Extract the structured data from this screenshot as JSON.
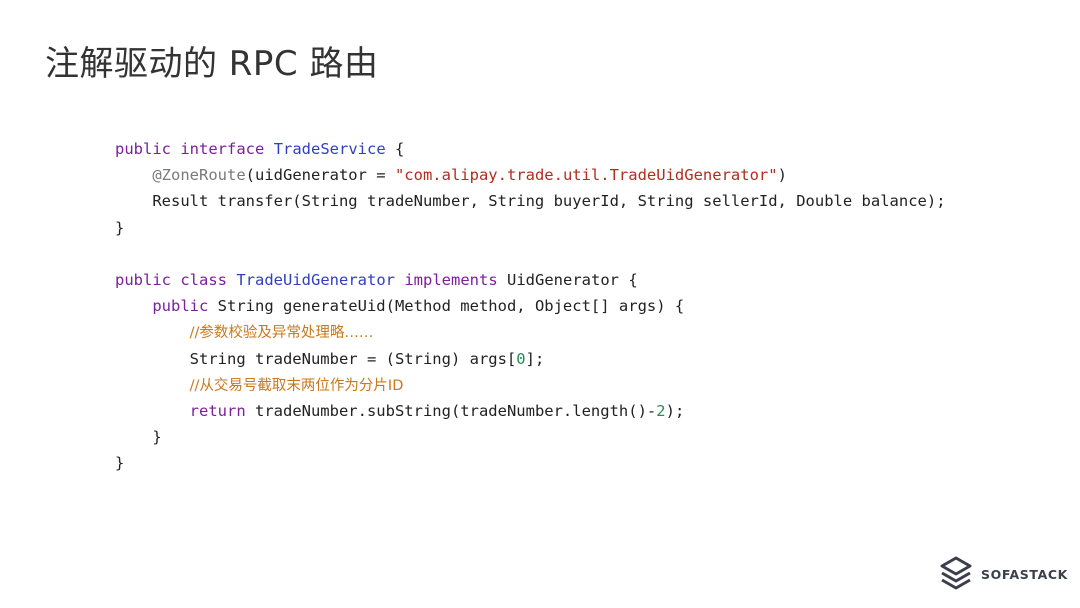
{
  "slide": {
    "title": "注解驱动的 RPC 路由"
  },
  "code": {
    "lines": [
      [
        {
          "t": "public",
          "k": "keyword"
        },
        {
          "t": " ",
          "k": "plain"
        },
        {
          "t": "interface",
          "k": "keyword"
        },
        {
          "t": " ",
          "k": "plain"
        },
        {
          "t": "TradeService",
          "k": "type"
        },
        {
          "t": " {",
          "k": "plain"
        }
      ],
      [
        {
          "t": "    ",
          "k": "plain"
        },
        {
          "t": "@ZoneRoute",
          "k": "annotation"
        },
        {
          "t": "(uidGenerator = ",
          "k": "plain"
        },
        {
          "t": "\"com.alipay.trade.util.TradeUidGenerator\"",
          "k": "string"
        },
        {
          "t": ")",
          "k": "plain"
        }
      ],
      [
        {
          "t": "    Result transfer(String tradeNumber, String buyerId, String sellerId, Double balance);",
          "k": "plain"
        }
      ],
      [
        {
          "t": "}",
          "k": "plain"
        }
      ],
      [
        {
          "t": "",
          "k": "plain"
        }
      ],
      [
        {
          "t": "public",
          "k": "keyword"
        },
        {
          "t": " ",
          "k": "plain"
        },
        {
          "t": "class",
          "k": "keyword"
        },
        {
          "t": " ",
          "k": "plain"
        },
        {
          "t": "TradeUidGenerator",
          "k": "type"
        },
        {
          "t": " ",
          "k": "plain"
        },
        {
          "t": "implements",
          "k": "keyword"
        },
        {
          "t": " UidGenerator {",
          "k": "plain"
        }
      ],
      [
        {
          "t": "    ",
          "k": "plain"
        },
        {
          "t": "public",
          "k": "keyword"
        },
        {
          "t": " String generateUid(Method method, Object[] args) {",
          "k": "plain"
        }
      ],
      [
        {
          "t": "        ",
          "k": "plain"
        },
        {
          "t": "//参数校验及异常处理略……",
          "k": "comment"
        }
      ],
      [
        {
          "t": "        String tradeNumber = (String) args[",
          "k": "plain"
        },
        {
          "t": "0",
          "k": "number"
        },
        {
          "t": "];",
          "k": "plain"
        }
      ],
      [
        {
          "t": "        ",
          "k": "plain"
        },
        {
          "t": "//从交易号截取末两位作为分片ID",
          "k": "comment"
        }
      ],
      [
        {
          "t": "        ",
          "k": "plain"
        },
        {
          "t": "return",
          "k": "keyword"
        },
        {
          "t": " tradeNumber.subString(tradeNumber.length()-",
          "k": "plain"
        },
        {
          "t": "2",
          "k": "number"
        },
        {
          "t": ");",
          "k": "plain"
        }
      ],
      [
        {
          "t": "    }",
          "k": "plain"
        }
      ],
      [
        {
          "t": "}",
          "k": "plain"
        }
      ]
    ]
  },
  "logo": {
    "icon": "sofastack-logo-icon",
    "text": "SOFASTACK"
  }
}
